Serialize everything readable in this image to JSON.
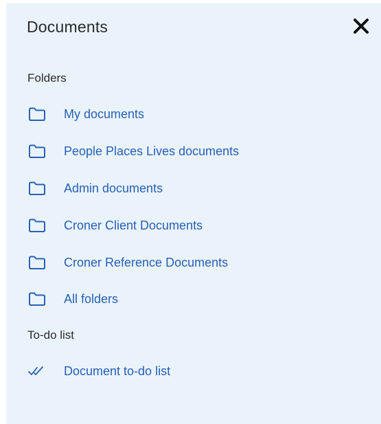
{
  "panel": {
    "title": "Documents",
    "close_icon": "close-icon"
  },
  "folders": {
    "heading": "Folders",
    "items": [
      {
        "label": "My documents",
        "icon": "folder-icon"
      },
      {
        "label": "People Places Lives documents",
        "icon": "folder-icon"
      },
      {
        "label": "Admin documents",
        "icon": "folder-icon"
      },
      {
        "label": "Croner Client Documents",
        "icon": "folder-icon"
      },
      {
        "label": "Croner Reference Documents",
        "icon": "folder-icon"
      },
      {
        "label": "All folders",
        "icon": "folder-icon"
      }
    ]
  },
  "todo": {
    "heading": "To-do list",
    "items": [
      {
        "label": "Document to-do list",
        "icon": "double-check-icon"
      }
    ]
  },
  "colors": {
    "panel_background": "#eaf3fc",
    "link": "#2860b5",
    "text": "#2b2b2b"
  }
}
